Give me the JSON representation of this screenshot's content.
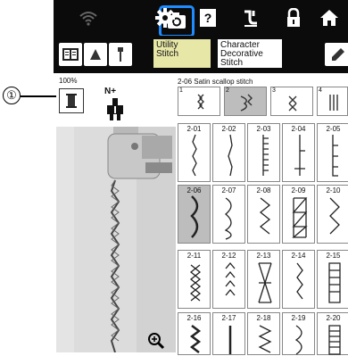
{
  "top_bar": {
    "icons": [
      "wifi-icon",
      "camera-icon",
      "settings-gear-icon",
      "help-icon",
      "threading-icon",
      "lock-icon",
      "home-icon"
    ],
    "help_glyph": "?"
  },
  "category_bar": {
    "tab_utility": "Utility\nStitch",
    "tab_utility_line1": "Utility",
    "tab_utility_line2": "Stitch",
    "tab_decorative_line1": "Character",
    "tab_decorative_line2": "Decorative",
    "tab_decorative_line3": "Stitch"
  },
  "left": {
    "zoom_percent": "100%",
    "callout": "①",
    "presser_foot": "N+"
  },
  "panel": {
    "title": "2-06  Satin scallop stitch",
    "categories": [
      "1",
      "2",
      "3",
      "4"
    ],
    "stitches": [
      [
        "2-01",
        "2-02",
        "2-03",
        "2-04",
        "2-05"
      ],
      [
        "2-06",
        "2-07",
        "2-08",
        "2-09",
        "2-10"
      ],
      [
        "2-11",
        "2-12",
        "2-13",
        "2-14",
        "2-15"
      ],
      [
        "2-16",
        "2-17",
        "2-18",
        "2-19",
        "2-20"
      ]
    ],
    "selected": "2-06"
  },
  "colors": {
    "highlight": "#1e8cff",
    "tab_active": "#e7e7a8",
    "selected_cell": "#bdbdbd"
  }
}
